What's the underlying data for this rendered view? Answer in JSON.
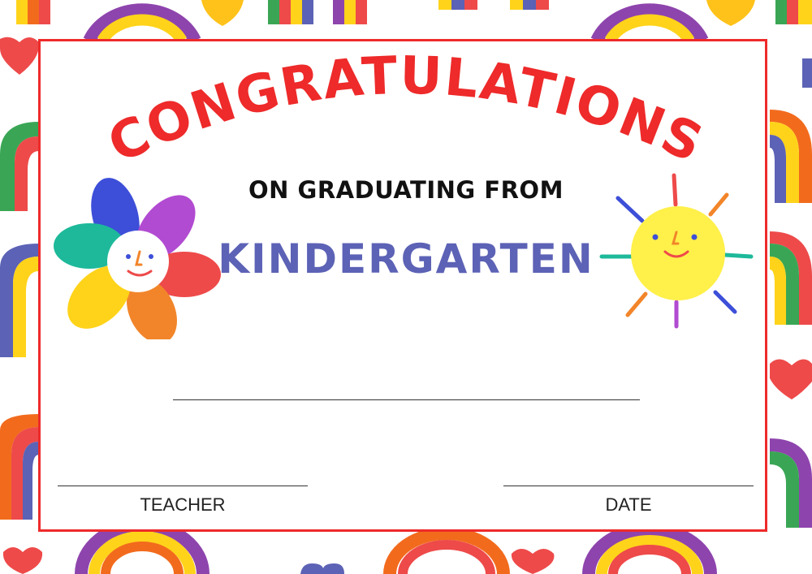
{
  "certificate": {
    "heading": "CONGRATULATIONS",
    "subheading": "ON GRADUATING FROM",
    "school_level": "KINDERGARTEN",
    "signatures": {
      "teacher_label": "TEACHER",
      "date_label": "DATE"
    }
  },
  "colors": {
    "heading": "#ee2a2a",
    "school_level": "#5c62b5",
    "border": "#ee2a2a"
  }
}
